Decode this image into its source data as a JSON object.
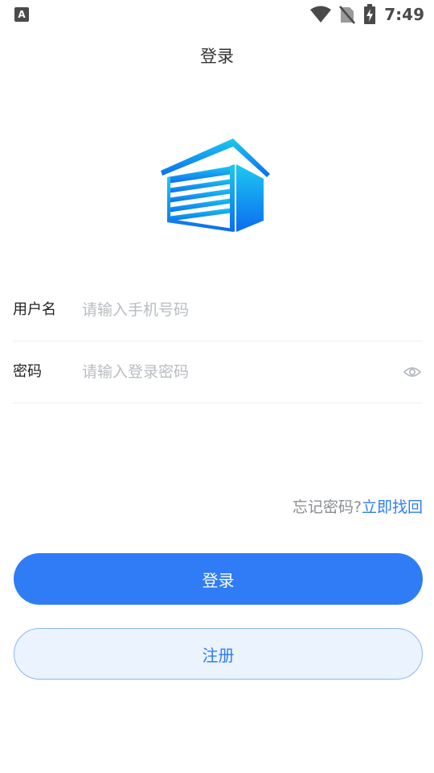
{
  "status_bar": {
    "left_icon_letter": "A",
    "time": "7:49"
  },
  "page": {
    "title": "登录"
  },
  "form": {
    "username": {
      "label": "用户名",
      "placeholder": "请输入手机号码"
    },
    "password": {
      "label": "密码",
      "placeholder": "请输入登录密码"
    }
  },
  "forgot": {
    "prompt": "忘记密码?",
    "link": "立即找回"
  },
  "buttons": {
    "login": "登录",
    "register": "注册"
  },
  "colors": {
    "primary": "#2f7cf6",
    "register_bg": "#eaf3fe",
    "logo_top": "#1ec8f0",
    "logo_bottom": "#0a6cf0"
  }
}
